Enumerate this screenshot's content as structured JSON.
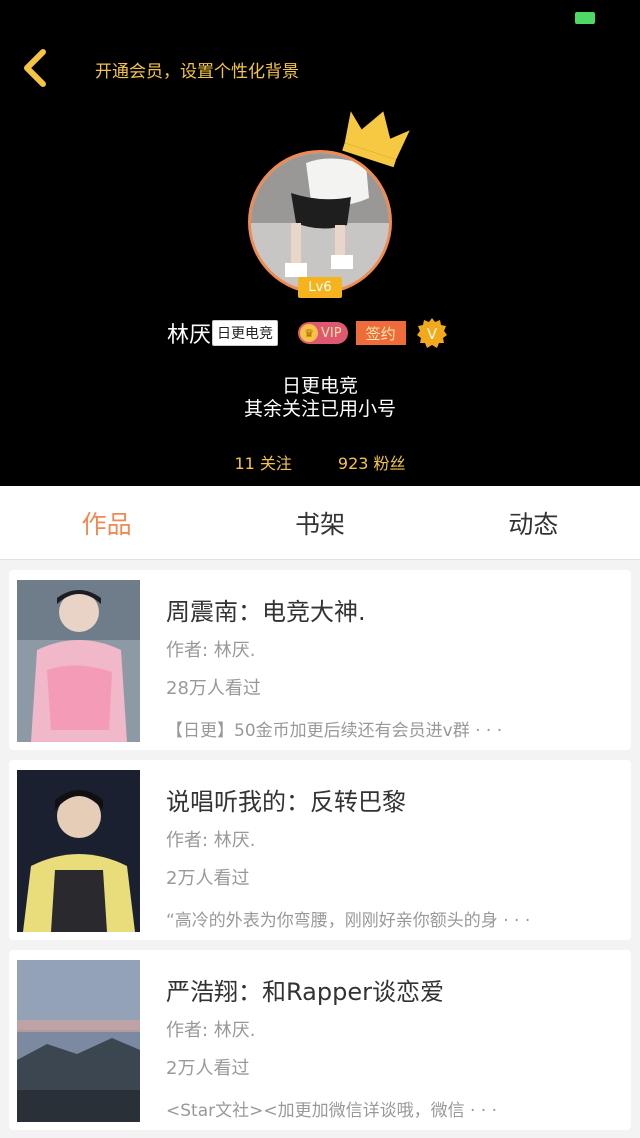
{
  "header": {
    "vip_bg_link": "开通会员，设置个性化背景",
    "level": "Lv6",
    "username": "林厌.",
    "tag": "日更电竞",
    "vip_label": "VIP",
    "sign_label": "签约",
    "v_label": "V",
    "bio_line1": "日更电竞",
    "bio_line2": "其余关注已用小号",
    "following": "11 关注",
    "followers": "923 粉丝"
  },
  "tabs": [
    {
      "label": "作品",
      "active": true
    },
    {
      "label": "书架",
      "active": false
    },
    {
      "label": "动态",
      "active": false
    }
  ],
  "works": [
    {
      "title": "周震南：电竞大神.",
      "author": "作者: 林厌.",
      "views": "28万人看过",
      "desc": "【日更】50金币加更后续还有会员进v群 · · ·"
    },
    {
      "title": "说唱听我的：反转巴黎",
      "author": "作者: 林厌.",
      "views": "2万人看过",
      "desc": "“高冷的外表为你弯腰，刚刚好亲你额头的身 · · ·"
    },
    {
      "title": "严浩翔：和Rapper谈恋爱",
      "author": "作者: 林厌.",
      "views": "2万人看过",
      "desc": "<Star文社><加更加微信详谈哦，微信 · · ·"
    }
  ],
  "colors": {
    "accent": "#f08a50",
    "gold": "#f5c542",
    "header_bg": "#000000"
  }
}
